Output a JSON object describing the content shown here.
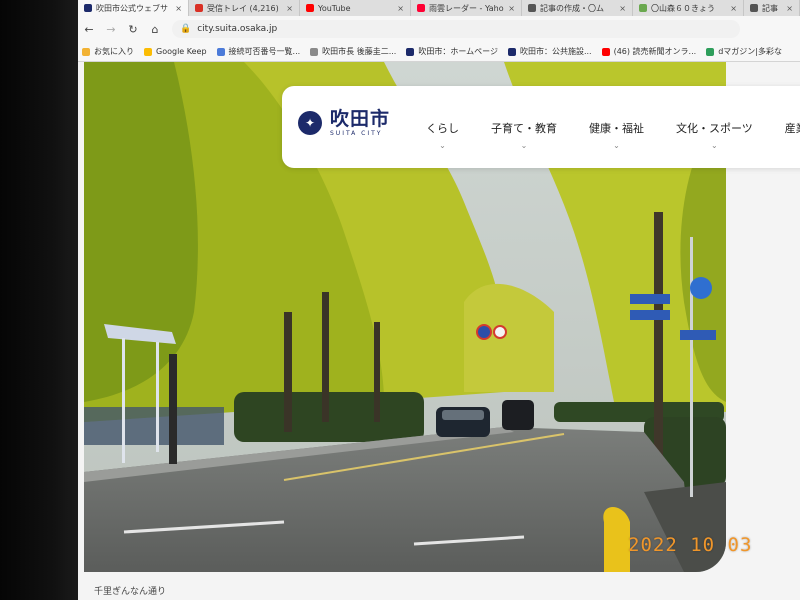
{
  "browser": {
    "tabs": [
      {
        "title": "吹田市公式ウェブサ",
        "color": "#1c2a6a",
        "active": true
      },
      {
        "title": "受信トレイ (4,216)",
        "color": "#d93025",
        "active": false
      },
      {
        "title": "YouTube",
        "color": "#ff0000",
        "active": false
      },
      {
        "title": "雨雲レーダー - Yaho",
        "color": "#ff0033",
        "active": false
      },
      {
        "title": "記事の作成・〇ム",
        "color": "#555555",
        "active": false
      },
      {
        "title": "〇山森６０きょう",
        "color": "#6aa84f",
        "active": false
      },
      {
        "title": "記事",
        "color": "#555555",
        "active": false
      }
    ],
    "address": "city.suita.osaka.jp",
    "bookmarks": [
      {
        "label": "お気に入り",
        "color": "#f2b233"
      },
      {
        "label": "Google Keep",
        "color": "#fbbc04"
      },
      {
        "label": "接続可否番号一覧...",
        "color": "#4c7bd9"
      },
      {
        "label": "吹田市長 後藤圭二...",
        "color": "#8a8a8a"
      },
      {
        "label": "吹田市：ホームページ",
        "color": "#1c2a6a"
      },
      {
        "label": "吹田市：公共施設...",
        "color": "#1c2a6a"
      },
      {
        "label": "(46) 読売新聞オンラ...",
        "color": "#ff0000"
      },
      {
        "label": "dマガジン|多彩な",
        "color": "#2e9e5b"
      }
    ]
  },
  "site": {
    "logo_jp": "吹田市",
    "logo_en": "SUITA CITY",
    "nav": [
      {
        "label": "くらし"
      },
      {
        "label": "子育て・教育"
      },
      {
        "label": "健康・福祉"
      },
      {
        "label": "文化・スポーツ"
      },
      {
        "label": "産業・ま"
      }
    ],
    "hero_caption": "千里ぎんなん通り"
  },
  "photo": {
    "datestamp": "2022 10 03"
  }
}
